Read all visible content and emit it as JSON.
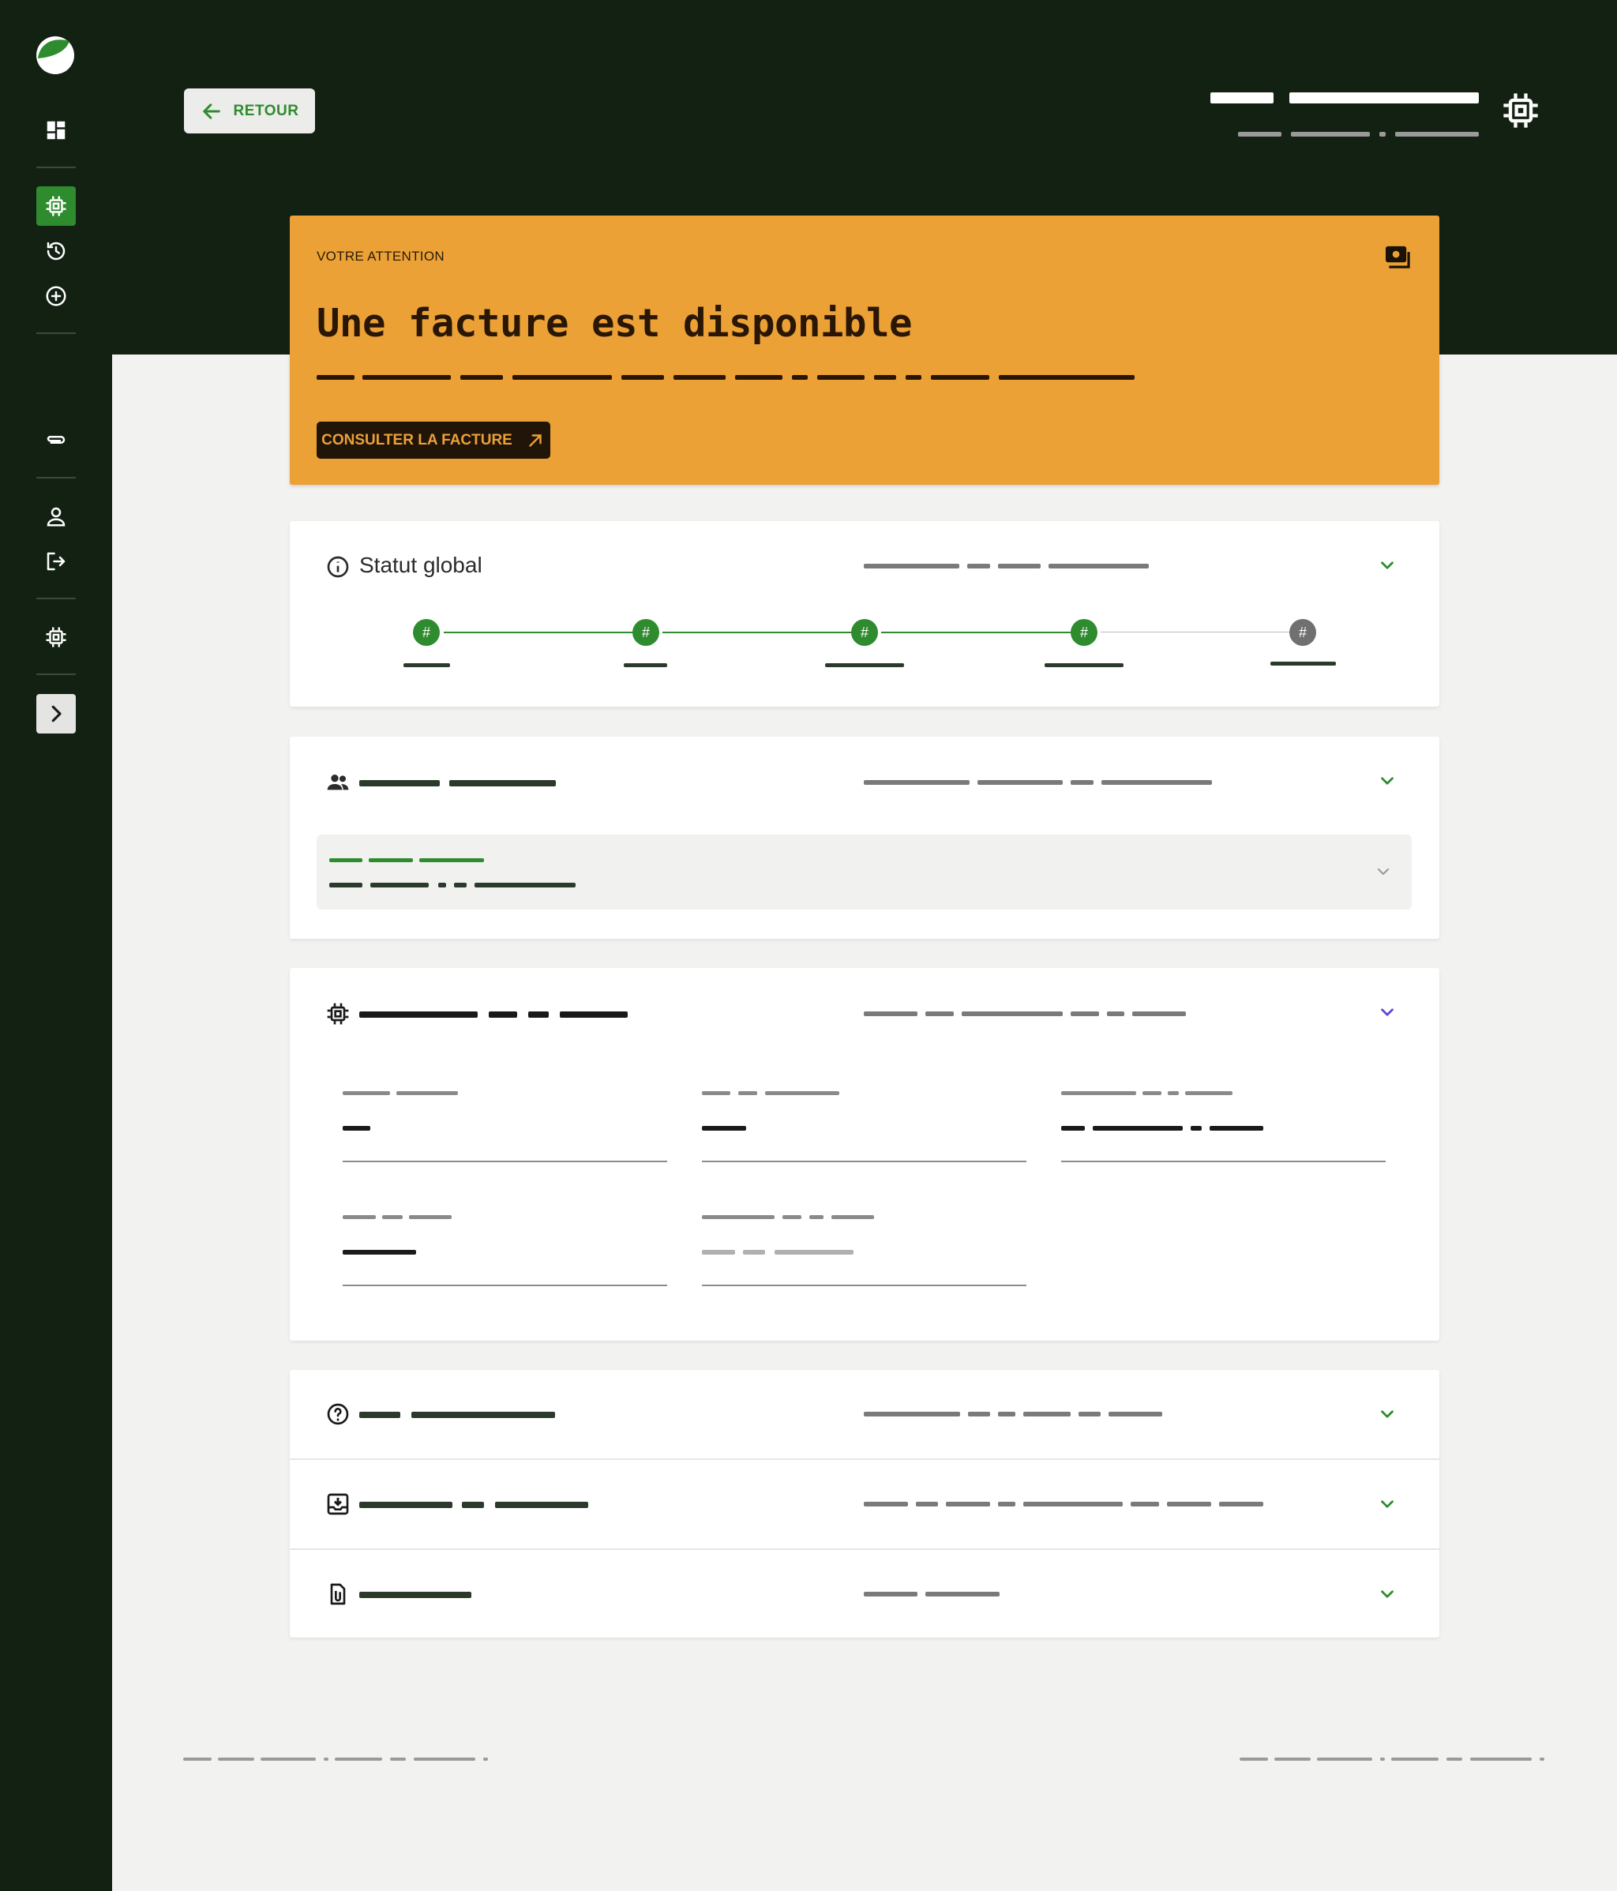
{
  "header": {
    "back_label": "RETOUR"
  },
  "sidebar": {
    "items": [
      {
        "icon": "dashboard-icon"
      },
      {
        "icon": "chip-icon",
        "active": true
      },
      {
        "icon": "history-icon"
      },
      {
        "icon": "add-circle-icon"
      },
      {
        "icon": "attachment-icon"
      },
      {
        "icon": "user-icon"
      },
      {
        "icon": "logout-icon"
      },
      {
        "icon": "chip-icon"
      },
      {
        "icon": "chevron-right-icon"
      }
    ]
  },
  "alert": {
    "eyebrow": "VOTRE ATTENTION",
    "title": "Une facture est disponible",
    "cta_label": "CONSULTER LA FACTURE",
    "icon": "invoice-icon"
  },
  "status_card": {
    "title": "Statut global",
    "steps": [
      {
        "symbol": "#",
        "done": true
      },
      {
        "symbol": "#",
        "done": true
      },
      {
        "symbol": "#",
        "done": true
      },
      {
        "symbol": "#",
        "done": true
      },
      {
        "symbol": "#",
        "done": false
      }
    ]
  },
  "colors": {
    "brand_dark": "#132113",
    "accent_green": "#2e8b2e",
    "alert_orange": "#eba136",
    "page_bg": "#f2f2f1"
  }
}
